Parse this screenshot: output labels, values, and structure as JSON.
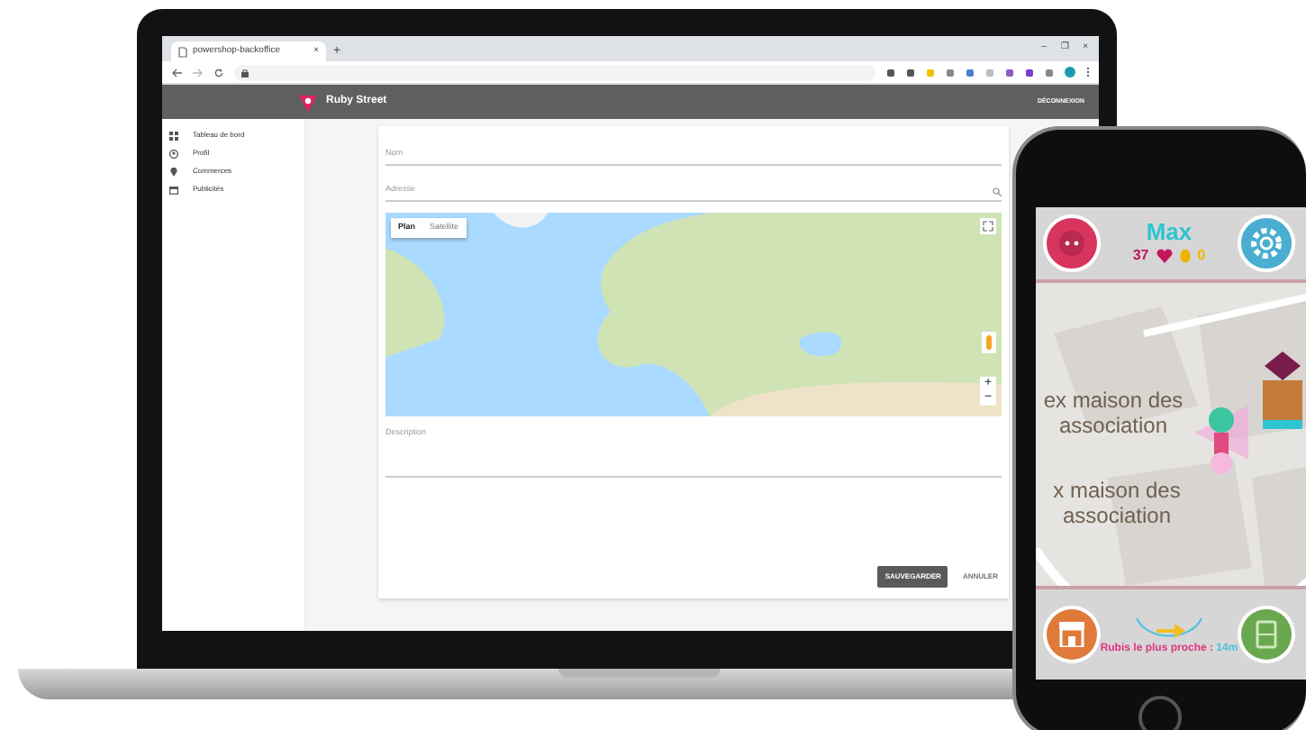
{
  "browser": {
    "tab_title": "powershop-backoffice",
    "tab_close": "×",
    "new_tab": "+",
    "window_controls": [
      "–",
      "❐",
      "×"
    ]
  },
  "app": {
    "brand": "Ruby Street",
    "logout": "DÉCONNEXION"
  },
  "sidebar": {
    "items": [
      {
        "label": "Tableau de bord"
      },
      {
        "label": "Profil"
      },
      {
        "label": "Commerces"
      },
      {
        "label": "Publicités"
      }
    ]
  },
  "form": {
    "fields": [
      {
        "placeholder": "Nom"
      },
      {
        "placeholder": "Adresse"
      }
    ],
    "map": {
      "map_types": [
        {
          "label": "Plan",
          "selected": true
        },
        {
          "label": "Satellite",
          "selected": false
        }
      ],
      "zoom": [
        "+",
        "−"
      ]
    },
    "description": {
      "placeholder": "Description"
    },
    "buttons": [
      {
        "label": "SAUVEGARDER",
        "kind": "primary"
      },
      {
        "label": "ANNULER",
        "kind": "text"
      }
    ]
  },
  "phone": {
    "player": "Max",
    "hearts": "37",
    "coins": "0",
    "map_labels": [
      "ex maison des association",
      "x maison des association"
    ],
    "nearest": {
      "label": "Rubis le plus proche :",
      "distance": "14m"
    }
  }
}
